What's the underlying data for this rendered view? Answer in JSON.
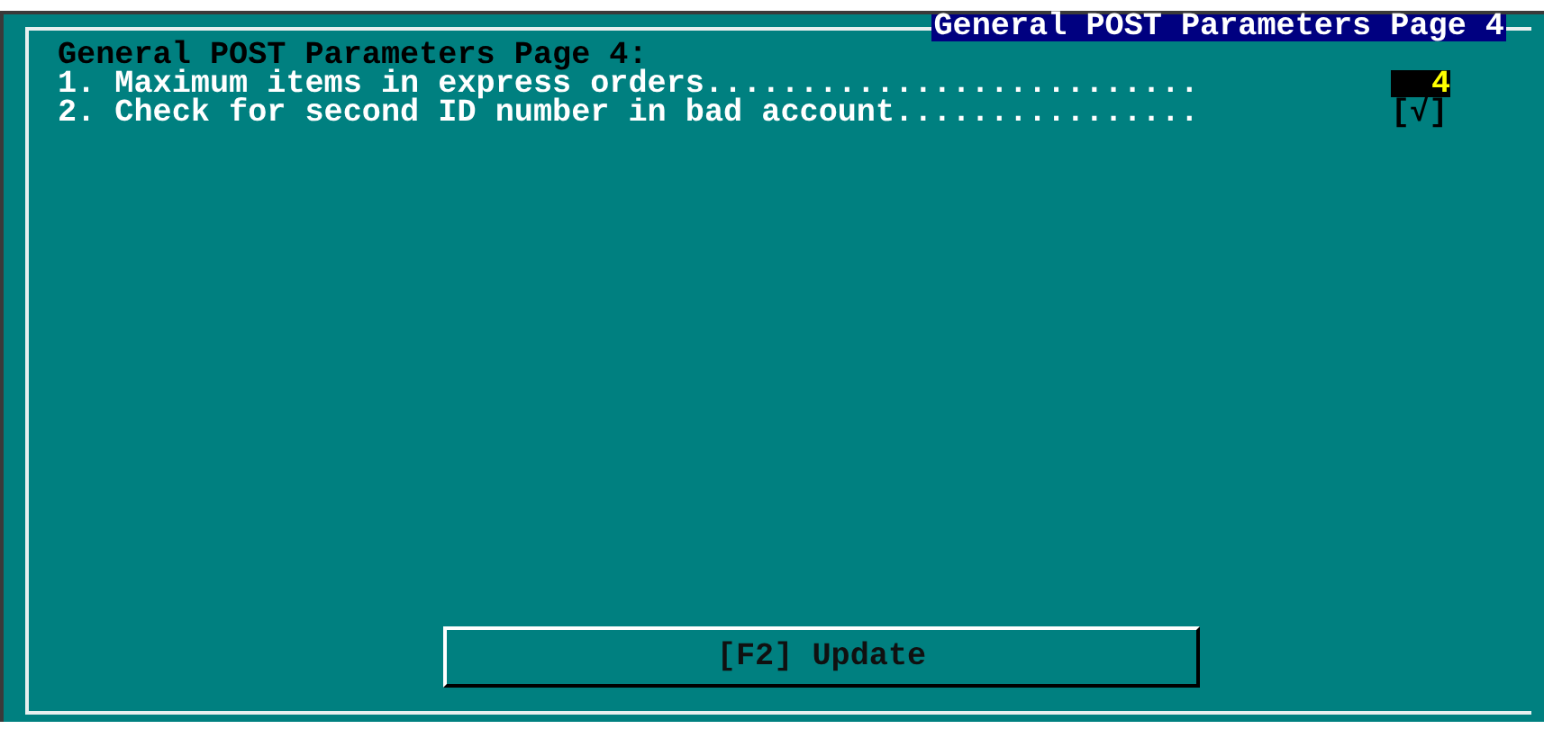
{
  "window": {
    "title": "General POST Parameters Page 4"
  },
  "heading": "General POST Parameters Page 4:",
  "parameters": [
    {
      "kind": "number",
      "label": "1. Maximum items in express orders..........................",
      "value": "4"
    },
    {
      "kind": "checkbox",
      "label": "2. Check for second ID number in bad account................",
      "checked": true,
      "open": "[",
      "mark": "√",
      "close": "]"
    }
  ],
  "buttons": [
    "[F2] Update"
  ]
}
